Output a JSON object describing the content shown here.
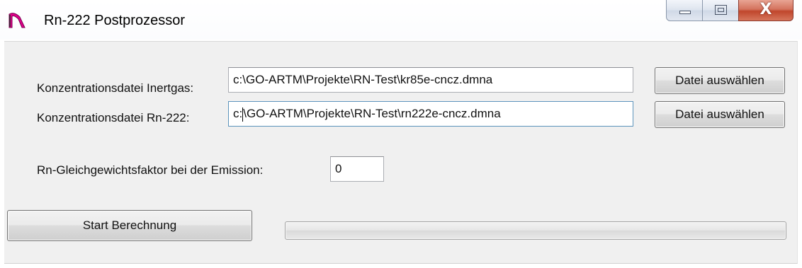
{
  "window": {
    "title": "Rn-222 Postprozessor",
    "icon": "app-icon",
    "controls": {
      "minimize": "minimize-icon",
      "maximize": "maximize-icon",
      "close_glyph": "X"
    }
  },
  "form": {
    "inertgas": {
      "label": "Konzentrationsdatei Inertgas:",
      "value": "c:\\GO-ARTM\\Projekte\\RN-Test\\kr85e-cncz.dmna",
      "button_label": "Datei auswählen"
    },
    "rn222": {
      "label": "Konzentrationsdatei Rn-222:",
      "value_before_caret": "c:",
      "value_after_caret": "\\GO-ARTM\\Projekte\\RN-Test\\rn222e-cncz.dmna",
      "button_label": "Datei auswählen"
    },
    "factor": {
      "label": "Rn-Gleichgewichtsfaktor bei der Emission:",
      "value": "0"
    }
  },
  "actions": {
    "start_label": "Start Berechnung"
  },
  "progress": {
    "value_percent": 0
  },
  "colors": {
    "client_bg": "#f0f0f0",
    "close_button": "#c0462c",
    "icon_magenta": "#e0008a"
  }
}
